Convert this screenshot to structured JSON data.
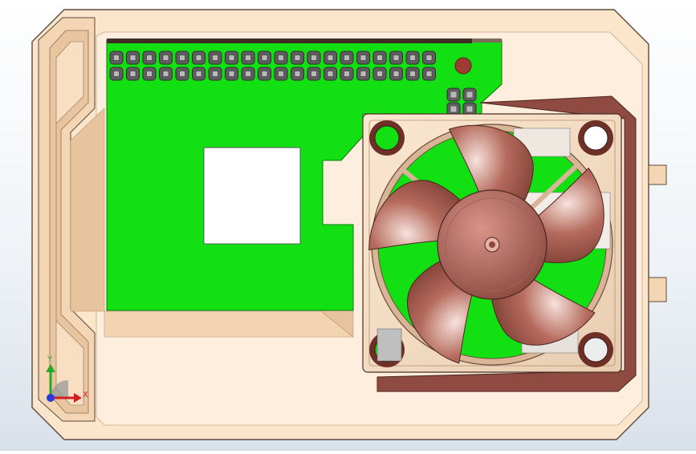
{
  "window": {
    "title": ""
  },
  "triad": {
    "x_label": "X",
    "y_label": "Y"
  },
  "colors": {
    "enclosure": "#fbe6cc",
    "enclosure_dark": "#d9b896",
    "pcb": "#12e012",
    "fan": "#8a4a40",
    "fan_light": "#d99a8e",
    "axis_x": "#d21f1f",
    "axis_y": "#28a628"
  },
  "icons": {
    "triad": "coordinate-triad-icon"
  }
}
